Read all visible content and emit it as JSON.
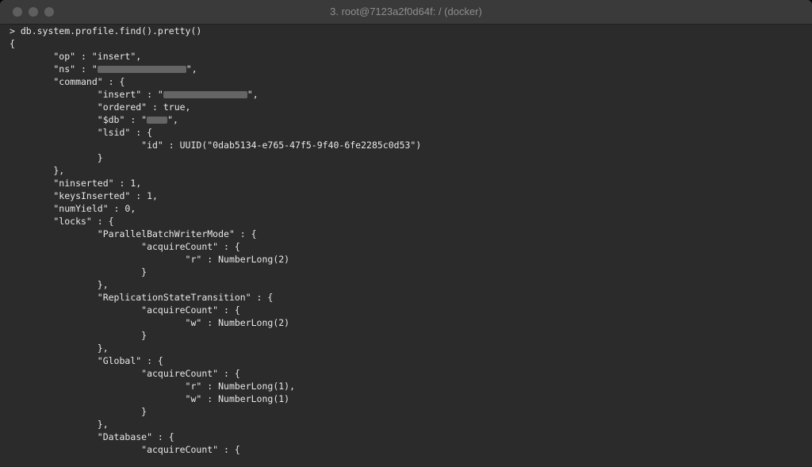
{
  "window": {
    "title": "3. root@7123a2f0d64f: / (docker)"
  },
  "terminal": {
    "lines": [
      "> db.system.profile.find().pretty()",
      "{",
      "        \"op\" : \"insert\",",
      "        \"ns\" : \"",
      "        \"command\" : {",
      "                \"insert\" : \"",
      "                \"ordered\" : true,",
      "                \"$db\" : \"",
      "                \"lsid\" : {",
      "                        \"id\" : UUID(\"0dab5134-e765-47f5-9f40-6fe2285c0d53\")",
      "                }",
      "        },",
      "        \"ninserted\" : 1,",
      "        \"keysInserted\" : 1,",
      "        \"numYield\" : 0,",
      "        \"locks\" : {",
      "                \"ParallelBatchWriterMode\" : {",
      "                        \"acquireCount\" : {",
      "                                \"r\" : NumberLong(2)",
      "                        }",
      "                },",
      "                \"ReplicationStateTransition\" : {",
      "                        \"acquireCount\" : {",
      "                                \"w\" : NumberLong(2)",
      "                        }",
      "                },",
      "                \"Global\" : {",
      "                        \"acquireCount\" : {",
      "                                \"r\" : NumberLong(1),",
      "                                \"w\" : NumberLong(1)",
      "                        }",
      "                },",
      "                \"Database\" : {",
      "                        \"acquireCount\" : {"
    ],
    "line_suffixes": {
      "ns": "\",",
      "insert": "\",",
      "db": "\","
    }
  }
}
